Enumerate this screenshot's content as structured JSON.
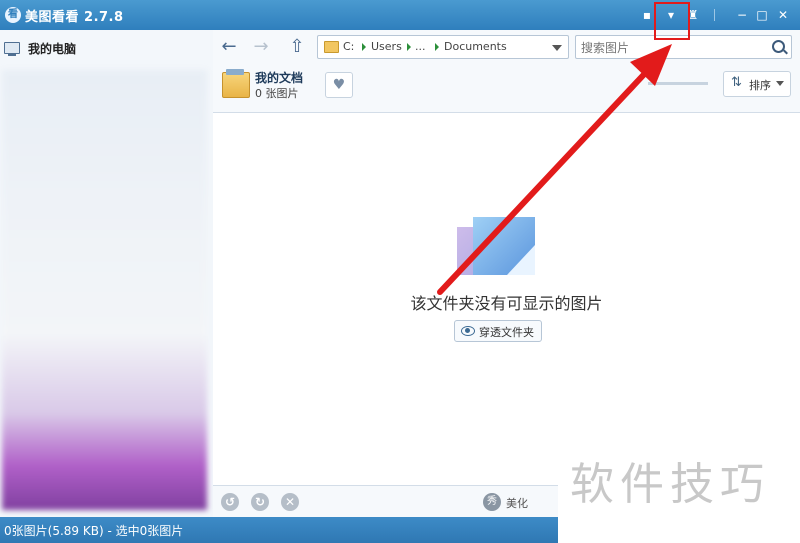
{
  "window": {
    "title": "美图看看 2.7.8",
    "logo_char": "看"
  },
  "titlebar_icons": [
    "chat-icon",
    "dropdown-icon",
    "shirt-icon",
    "minimize-icon",
    "maximize-icon",
    "close-icon"
  ],
  "sidebar": {
    "items": [
      {
        "label": "我的电脑",
        "icon": "monitor-icon"
      }
    ]
  },
  "toolbar": {
    "breadcrumb": [
      "C:",
      "Users",
      "...",
      "Documents"
    ],
    "search_placeholder": "搜索图片"
  },
  "folder": {
    "name": "我的文档",
    "count": "0 张图片",
    "sort_label": "排序"
  },
  "main": {
    "empty_message": "该文件夹没有可显示的图片",
    "see_through_label": "穿透文件夹"
  },
  "bottombar": {
    "beautify_label": "美化",
    "beautify_icon_char": "秀"
  },
  "statusbar": {
    "text": "0张图片(5.89 KB) - 选中0张图片"
  },
  "watermark": {
    "text": "软件技巧"
  },
  "colors": {
    "titlebar": "#2f7fbd",
    "statusbar": "#2f78b3",
    "annotation": "#e21b1b"
  }
}
